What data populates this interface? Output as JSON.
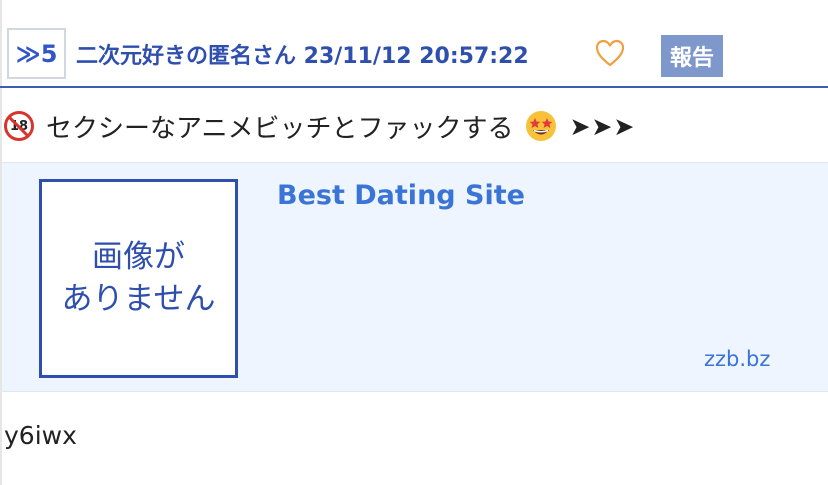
{
  "post": {
    "res_label": "≫5",
    "author_and_date": "二次元好きの匿名さん 23/11/12 20:57:22",
    "report_label": "報告",
    "body_text": "セクシーなアニメビッチとファックする",
    "arrows": "➤➤➤",
    "badge_text": "18",
    "footer_id": "y6iwx"
  },
  "ad": {
    "image_placeholder_line1": "画像が",
    "image_placeholder_line2": "ありません",
    "title": "Best Dating Site",
    "domain": "zzb.bz"
  },
  "icons": {
    "heart": "heart-outline-icon",
    "age_restriction": "no-under-18-icon",
    "emoji": "star-struck-emoji-icon"
  },
  "colors": {
    "accent_blue": "#2f4fae",
    "link_blue": "#3a74d6",
    "report_bg": "#7f98cb",
    "heart_orange": "#f0a040",
    "ad_bg": "#eef5fe"
  }
}
